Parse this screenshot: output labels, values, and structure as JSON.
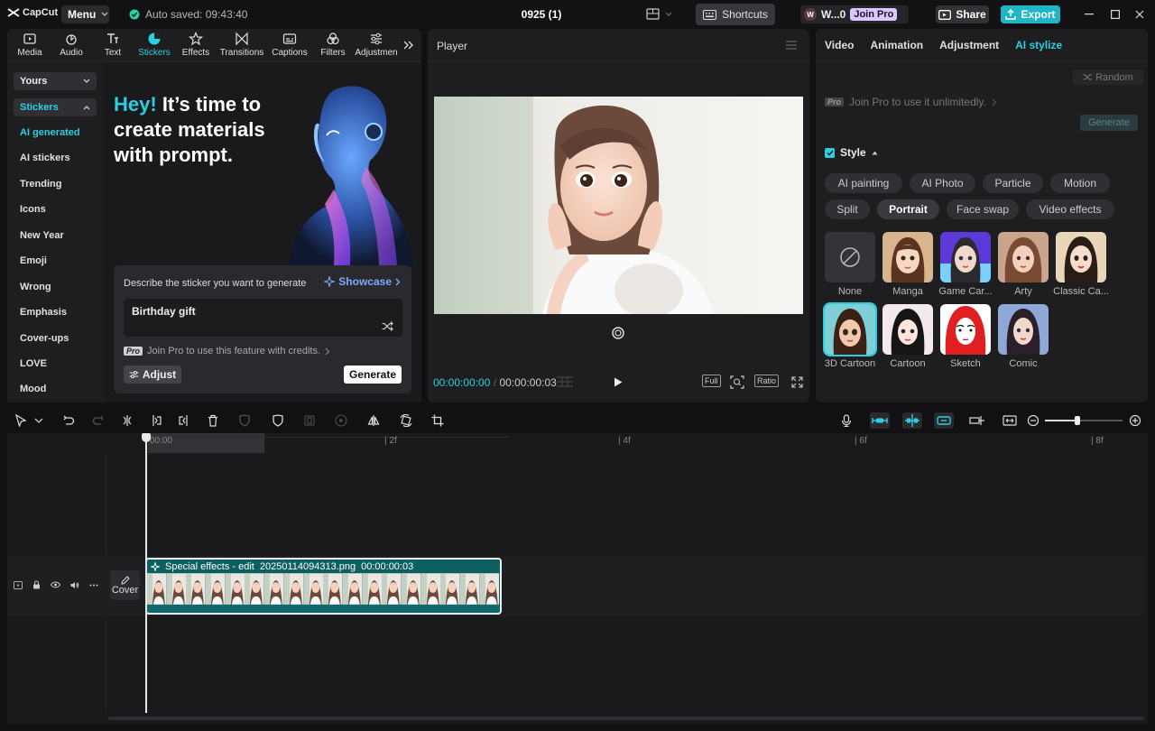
{
  "app": {
    "logo": "CapCut",
    "menu_label": "Menu",
    "autosave": "Auto saved: 09:43:40",
    "project_title": "0925 (1)",
    "shortcuts_label": "Shortcuts",
    "user_initial": "W",
    "user_name": "W...0",
    "join_pro": "Join Pro",
    "share_label": "Share",
    "export_label": "Export"
  },
  "left_tabs": [
    {
      "label": "Media",
      "icon": "media-icon"
    },
    {
      "label": "Audio",
      "icon": "audio-icon"
    },
    {
      "label": "Text",
      "icon": "text-icon"
    },
    {
      "label": "Stickers",
      "icon": "stickers-icon",
      "active": true
    },
    {
      "label": "Effects",
      "icon": "effects-icon"
    },
    {
      "label": "Transitions",
      "icon": "transitions-icon"
    },
    {
      "label": "Captions",
      "icon": "captions-icon"
    },
    {
      "label": "Filters",
      "icon": "filters-icon"
    },
    {
      "label": "Adjustmen",
      "icon": "adjustment-icon"
    }
  ],
  "sidebar": {
    "yours": "Yours",
    "stickers": "Stickers",
    "items": [
      "AI generated",
      "AI stickers",
      "Trending",
      "Icons",
      "New Year",
      "Emoji",
      "Wrong",
      "Emphasis",
      "Cover-ups",
      "LOVE",
      "Mood"
    ]
  },
  "stickers_panel": {
    "hero_hey": "Hey!",
    "hero_rest_1": "It’s time to",
    "hero_line_2": "create materials",
    "hero_line_3": "with prompt.",
    "prompt_label": "Describe the sticker you want to generate",
    "showcase": "Showcase",
    "prompt_value": "Birthday gift",
    "pro_badge": "Pro",
    "pro_note": "Join Pro to use this feature with credits.",
    "adjust": "Adjust",
    "generate": "Generate"
  },
  "player": {
    "title": "Player",
    "current_time": "00:00:00:00",
    "separator": "/",
    "total_time": "00:00:00:03",
    "full": "Full",
    "ratio": "Ratio"
  },
  "right_panel": {
    "tabs": [
      "Video",
      "Animation",
      "Adjustment",
      "AI stylize"
    ],
    "active_tab": "AI stylize",
    "random": "Random",
    "pro_badge": "Pro",
    "pro_note": "Join Pro to use it unlimitedly.",
    "generate": "Generate",
    "style_label": "Style",
    "chips_row1": [
      "AI painting",
      "AI Photo",
      "Particle",
      "Motion"
    ],
    "chips_row2": [
      "Split",
      "Portrait",
      "Face swap",
      "Video effects"
    ],
    "active_chip": "Portrait",
    "styles_row1": [
      "None",
      "Manga",
      "Game Car...",
      "Arty",
      "Classic Ca..."
    ],
    "styles_row2": [
      "3D Cartoon",
      "Cartoon",
      "Sketch",
      "Comic"
    ],
    "selected_style": "3D Cartoon"
  },
  "timeline": {
    "ruler": [
      "00:00",
      "| 2f",
      "| 4f",
      "| 6f",
      "| 8f"
    ],
    "clip_effect": "Special effects - edit",
    "clip_file": "20250114094313.png",
    "clip_duration": "00:00:00:03",
    "cover_label": "Cover"
  },
  "colors": {
    "accent": "#2bd0e0",
    "export_bg": "#1fb7c8",
    "clip_bg": "#0e6a6e",
    "pro": "#d9c8ff"
  }
}
